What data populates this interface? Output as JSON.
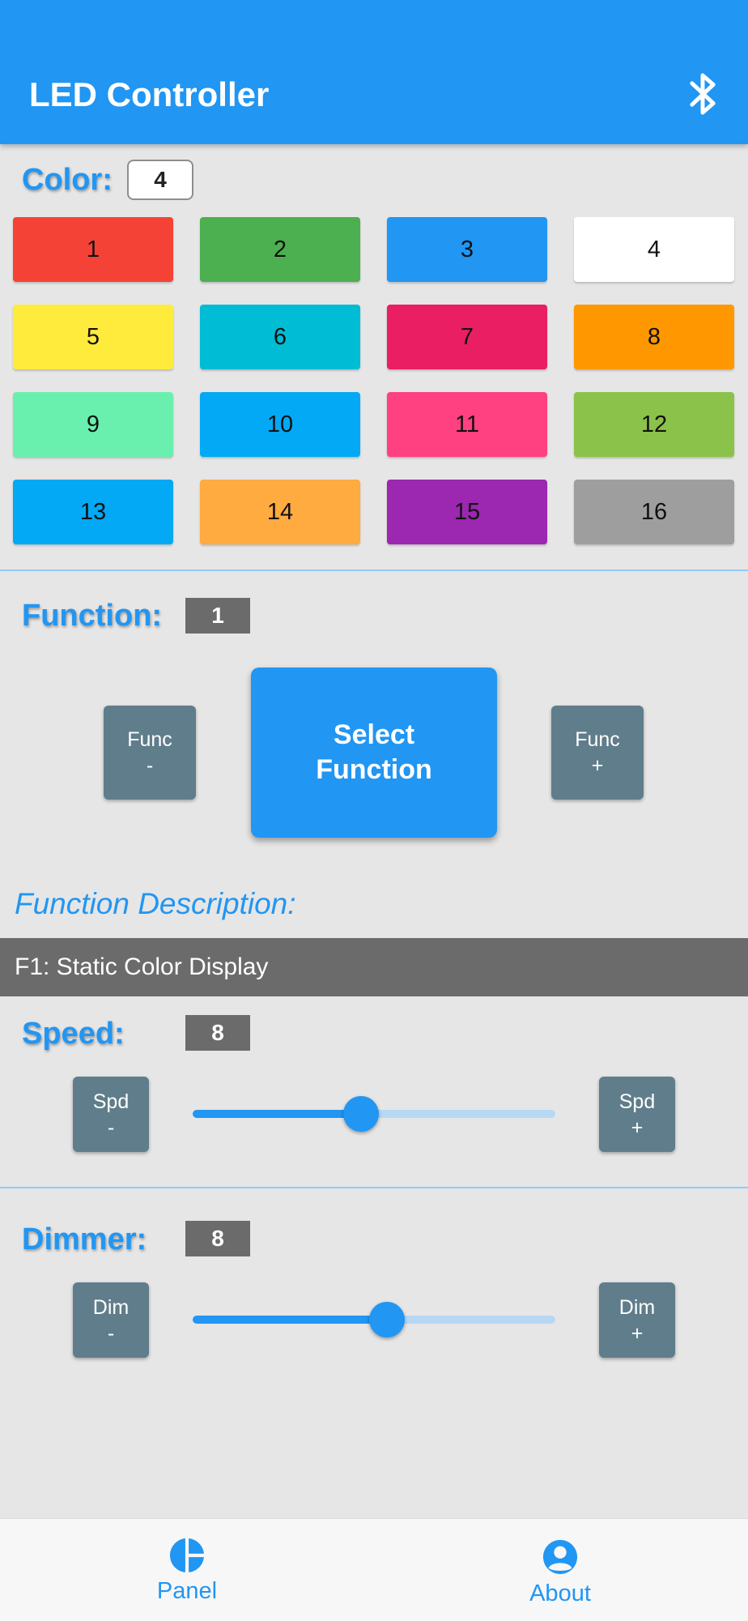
{
  "app": {
    "title": "LED Controller",
    "accent_color": "#2196f3",
    "bluetooth_icon": "bluetooth-icon"
  },
  "color": {
    "label": "Color:",
    "value": "4",
    "swatches": [
      {
        "label": "1",
        "color": "#f44336"
      },
      {
        "label": "2",
        "color": "#4caf50"
      },
      {
        "label": "3",
        "color": "#2196f3"
      },
      {
        "label": "4",
        "color": "#ffffff"
      },
      {
        "label": "5",
        "color": "#ffeb3b"
      },
      {
        "label": "6",
        "color": "#00bcd4"
      },
      {
        "label": "7",
        "color": "#e91e63"
      },
      {
        "label": "8",
        "color": "#ff9800"
      },
      {
        "label": "9",
        "color": "#69f0ae"
      },
      {
        "label": "10",
        "color": "#03a9f4"
      },
      {
        "label": "11",
        "color": "#ff4081"
      },
      {
        "label": "12",
        "color": "#8bc34a"
      },
      {
        "label": "13",
        "color": "#03a9f4"
      },
      {
        "label": "14",
        "color": "#ffab40"
      },
      {
        "label": "15",
        "color": "#9c27b0"
      },
      {
        "label": "16",
        "color": "#9e9e9e"
      }
    ]
  },
  "function": {
    "label": "Function:",
    "value": "1",
    "prev_line1": "Func",
    "prev_line2": "-",
    "select_line1": "Select",
    "select_line2": "Function",
    "next_line1": "Func",
    "next_line2": "+",
    "description_title": "Function Description:",
    "description": "F1: Static Color Display"
  },
  "speed": {
    "label": "Speed:",
    "value": "8",
    "minus_line1": "Spd",
    "minus_line2": "-",
    "plus_line1": "Spd",
    "plus_line2": "+",
    "slider_level": 0.465
  },
  "dimmer": {
    "label": "Dimmer:",
    "value": "8",
    "minus_line1": "Dim",
    "minus_line2": "-",
    "plus_line1": "Dim",
    "plus_line2": "+",
    "slider_level": 0.535
  },
  "bottom_nav": {
    "items": [
      {
        "label": "Panel",
        "icon": "panel-icon"
      },
      {
        "label": "About",
        "icon": "account-circle-icon"
      }
    ]
  }
}
